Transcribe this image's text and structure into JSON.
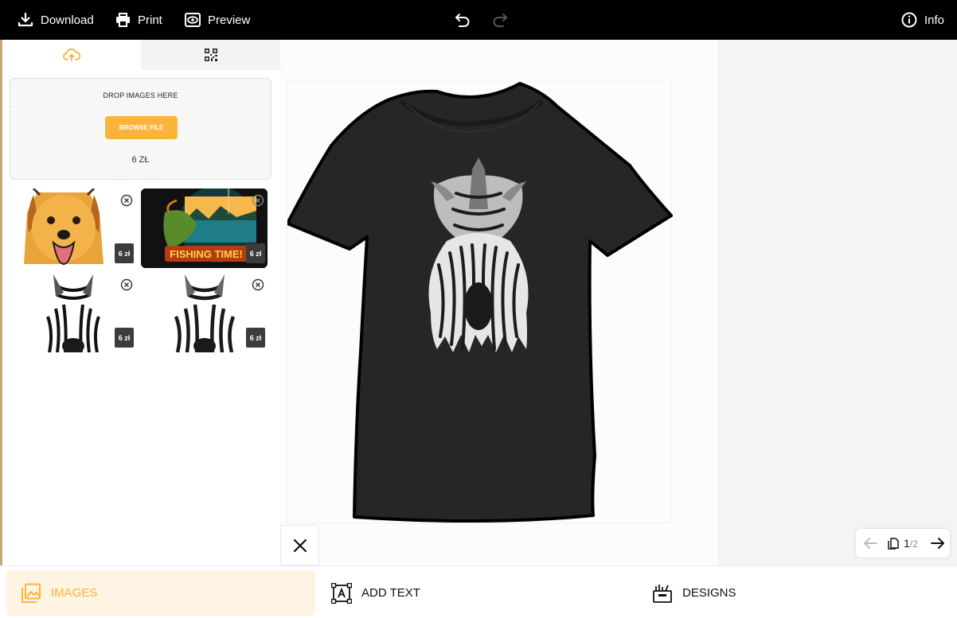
{
  "topbar": {
    "download_label": "Download",
    "print_label": "Print",
    "preview_label": "Preview",
    "info_label": "Info"
  },
  "left_panel": {
    "tabs": [
      {
        "icon": "cloud-upload-icon",
        "active": true
      },
      {
        "icon": "qr-code-icon",
        "active": false
      }
    ],
    "dropzone": {
      "title": "DROP IMAGES HERE",
      "browse_label": "BROWSE FILE",
      "price": "6 ZŁ"
    },
    "images": [
      {
        "name": "dog cartoon",
        "price": "6 zł"
      },
      {
        "name": "fishing time",
        "price": "6 zł",
        "text": "FISHING TIME!"
      },
      {
        "name": "zebra 1",
        "price": "6 zł"
      },
      {
        "name": "zebra 2",
        "price": "6 zł"
      }
    ]
  },
  "pager": {
    "current": "1",
    "total": "/2"
  },
  "bottombar": {
    "images_label": "IMAGES",
    "add_text_label": "ADD TEXT",
    "designs_label": "DESIGNS"
  },
  "colors": {
    "accent": "#fbb33b",
    "topbar_bg": "#000000",
    "shirt": "#262626",
    "active_tab_bg": "#fff4e3"
  }
}
